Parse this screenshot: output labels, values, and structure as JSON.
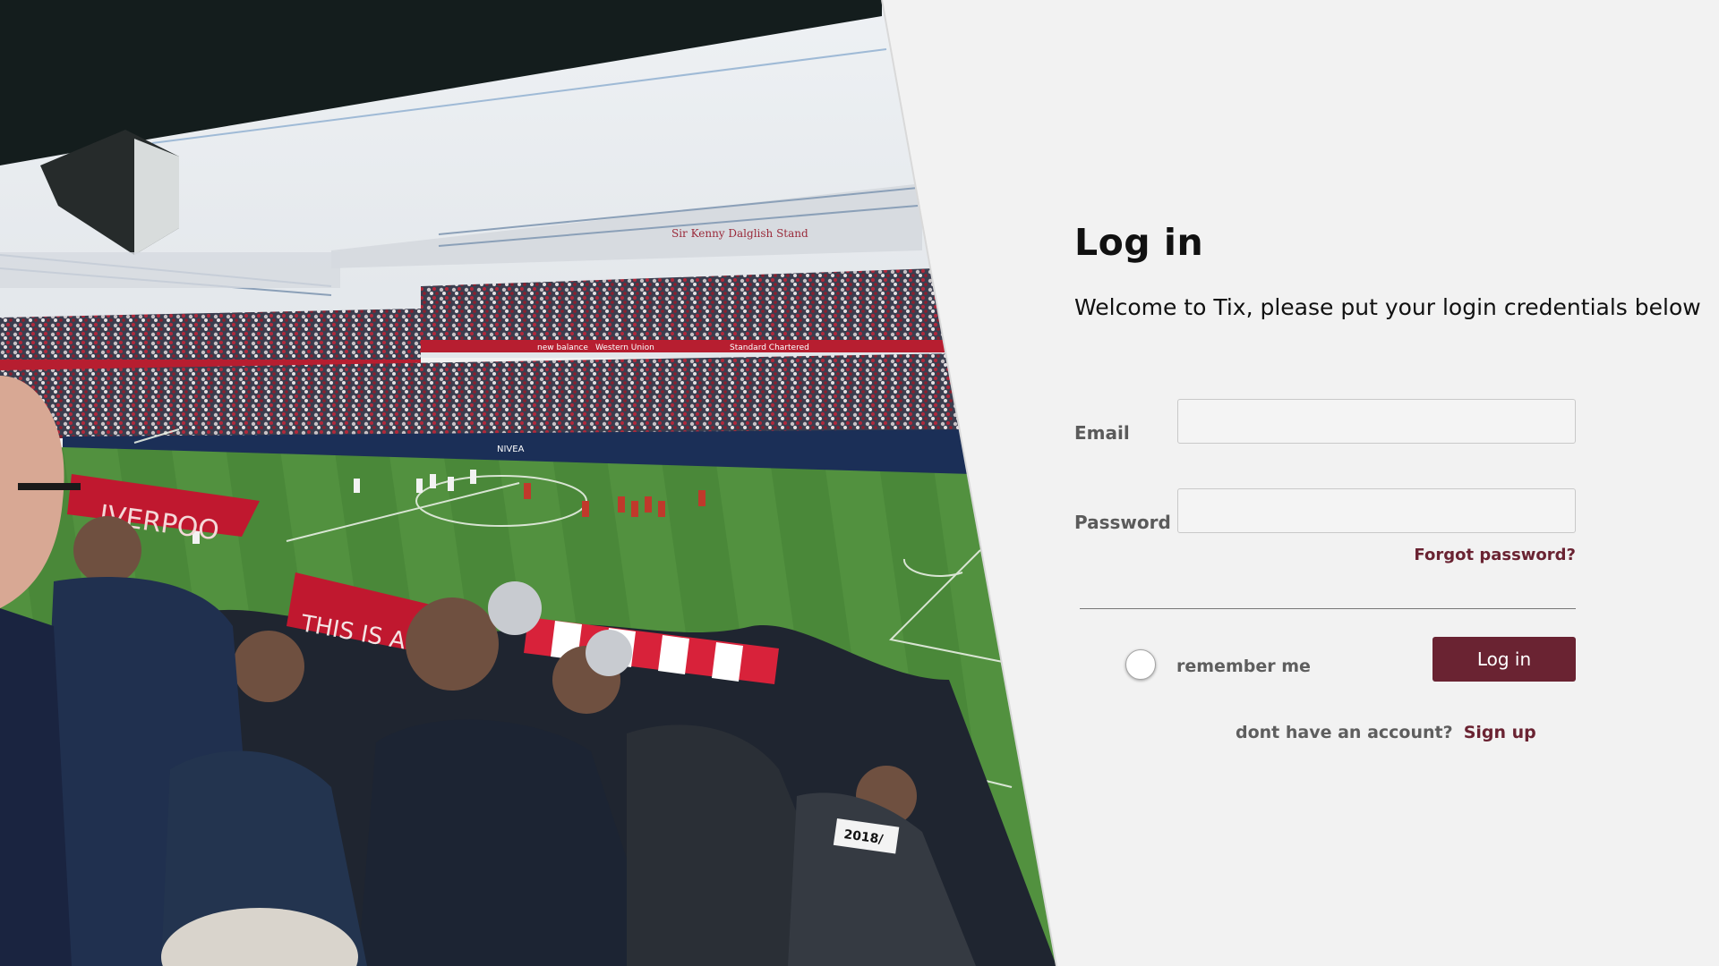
{
  "login": {
    "title": "Log in",
    "subtitle": "Welcome to Tix, please put your login credentials below",
    "email_label": "Email",
    "email_value": "",
    "password_label": "Password",
    "password_value": "",
    "forgot_password": "Forgot password?",
    "remember_me": "remember me",
    "submit_label": "Log in",
    "signup_prompt": "dont have an account?",
    "signup_link": "Sign up"
  },
  "hero": {
    "description_icon": "stadium-photo",
    "scarf_text_1": "IVERPOO",
    "scarf_text_2": "THIS IS ANF",
    "stand_banner": "Sir Kenny Dalglish Stand",
    "sponsor_1": "new balance",
    "sponsor_2": "Standard Chartered",
    "sponsor_3": "Western Union",
    "sponsor_4": "NIVEA",
    "cap_badge": "2018/"
  },
  "colors": {
    "accent": "#6a2332",
    "panel_background": "#f2f2f2",
    "pitch_green": "#4c8a3a"
  }
}
